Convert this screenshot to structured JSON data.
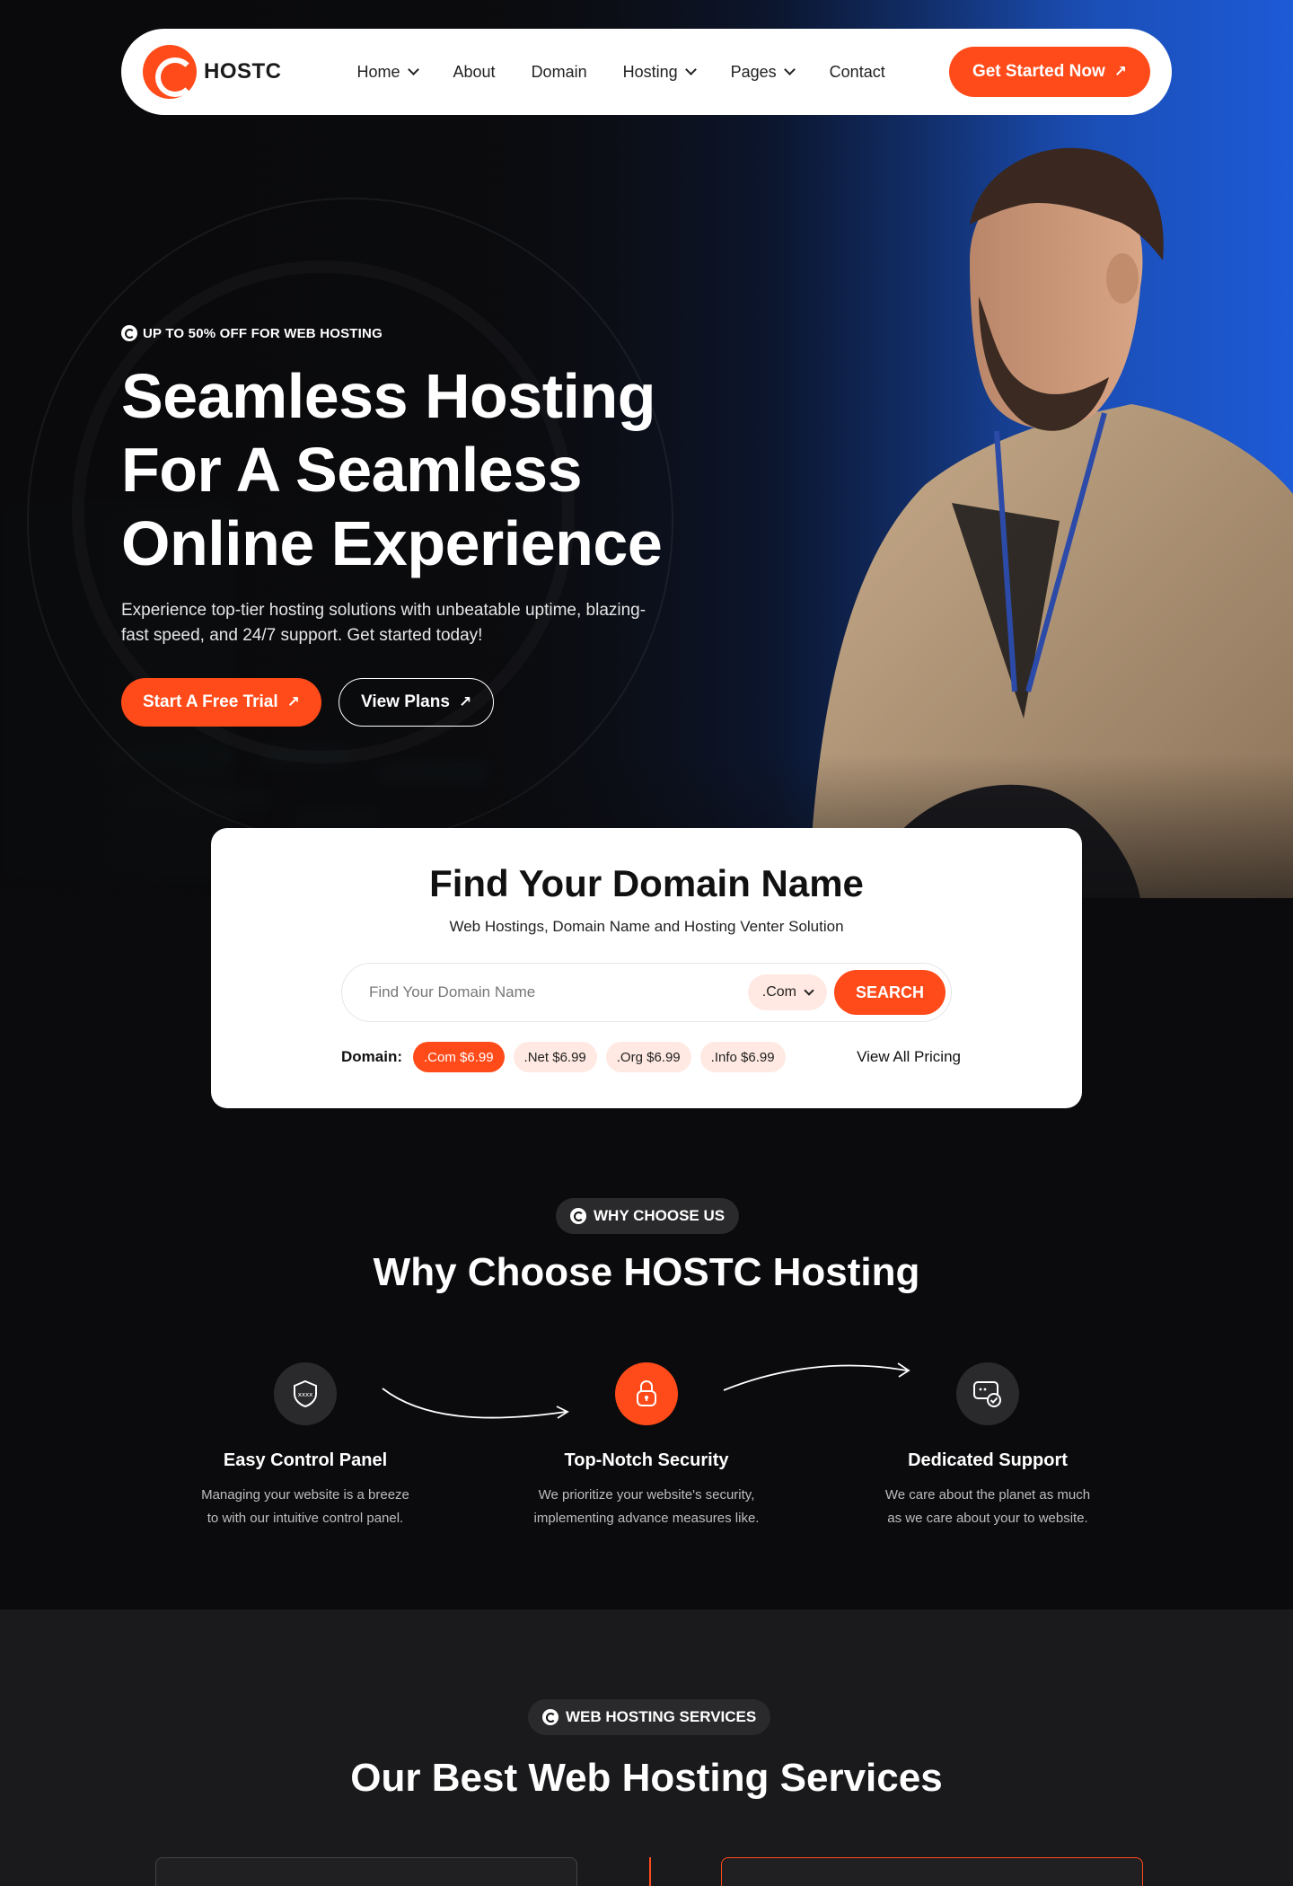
{
  "brand": {
    "name": "HOSTC",
    "accent": "#ff4b1a"
  },
  "nav": {
    "items": [
      {
        "label": "Home",
        "has_dropdown": true
      },
      {
        "label": "About",
        "has_dropdown": false
      },
      {
        "label": "Domain",
        "has_dropdown": false
      },
      {
        "label": "Hosting",
        "has_dropdown": true
      },
      {
        "label": "Pages",
        "has_dropdown": true
      },
      {
        "label": "Contact",
        "has_dropdown": false
      }
    ],
    "cta": "Get Started Now"
  },
  "hero": {
    "eyebrow": "UP TO 50% OFF FOR WEB HOSTING",
    "headline": [
      "Seamless Hosting",
      "For A Seamless",
      "Online Experience"
    ],
    "subtext": "Experience top-tier hosting solutions with unbeatable uptime, blazing-fast speed, and 24/7 support. Get started today!",
    "primary_button": "Start A Free Trial",
    "secondary_button": "View Plans"
  },
  "domain_search": {
    "title": "Find Your Domain Name",
    "subtitle": "Web Hostings, Domain Name and Hosting Venter Solution",
    "placeholder": "Find Your Domain Name",
    "tld_selected": ".Com",
    "search_button": "SEARCH",
    "pricing_label": "Domain:",
    "prices": [
      {
        "label": ".Com  $6.99",
        "active": true
      },
      {
        "label": ".Net  $6.99",
        "active": false
      },
      {
        "label": ".Org  $6.99",
        "active": false
      },
      {
        "label": ".Info  $6.99",
        "active": false
      }
    ],
    "view_all": "View All Pricing"
  },
  "why": {
    "badge": "WHY CHOOSE US",
    "title": "Why Choose HOSTC Hosting",
    "features": [
      {
        "title": "Easy Control Panel",
        "desc": [
          "Managing your website is a breeze",
          "to with our intuitive control panel."
        ],
        "icon": "shield-password-icon"
      },
      {
        "title": "Top-Notch Security",
        "desc": [
          "We prioritize your website's security,",
          "implementing advance measures like."
        ],
        "icon": "lock-icon"
      },
      {
        "title": "Dedicated Support",
        "desc": [
          "We care about the planet as much",
          "as we care about your to website."
        ],
        "icon": "support-chat-icon"
      }
    ]
  },
  "services": {
    "badge": "WEB HOSTING SERVICES",
    "title": "Our Best Web Hosting Services"
  }
}
